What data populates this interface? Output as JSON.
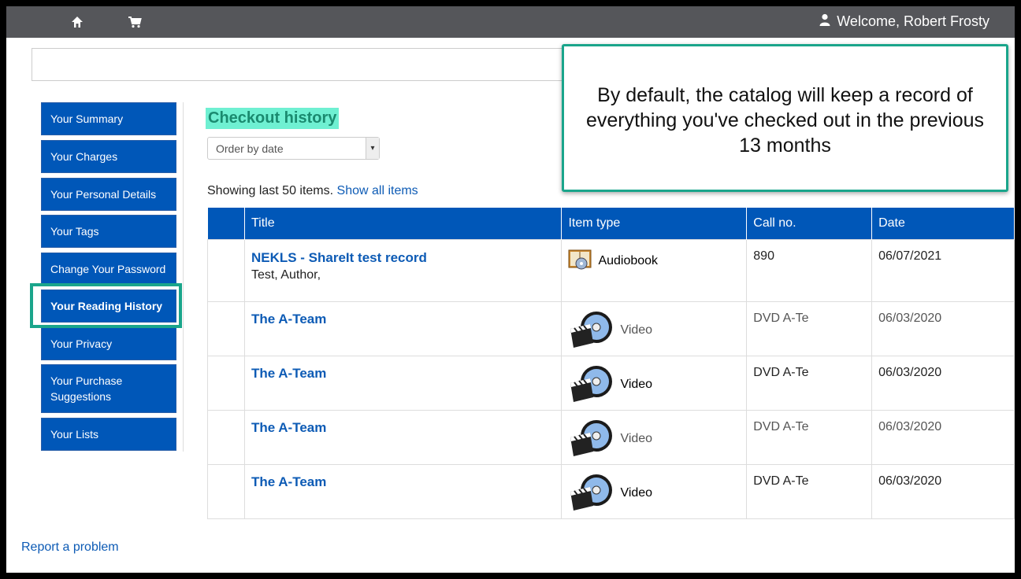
{
  "header": {
    "home_icon": "home-icon",
    "cart_icon": "cart-icon",
    "user_icon": "user-icon",
    "welcome": "Welcome, Robert Frosty"
  },
  "sidebar": {
    "items": [
      {
        "label": "Your Summary"
      },
      {
        "label": "Your Charges"
      },
      {
        "label": "Your Personal Details"
      },
      {
        "label": "Your Tags"
      },
      {
        "label": "Change Your Password"
      },
      {
        "label": "Your Reading History",
        "active": true
      },
      {
        "label": "Your Privacy"
      },
      {
        "label": "Your Purchase Suggestions"
      },
      {
        "label": "Your Lists"
      }
    ]
  },
  "main": {
    "title": "Checkout history",
    "order_select": "Order by date",
    "showing_text": "Showing last 50 items.",
    "show_all_link": "Show all items",
    "table": {
      "headers": [
        "",
        "Title",
        "Item type",
        "Call no.",
        "Date"
      ],
      "rows": [
        {
          "title": "NEKLS - ShareIt test record",
          "author": "Test, Author,",
          "type": "Audiobook",
          "type_icon": "audiobook-icon",
          "call_no": "890",
          "date": "06/07/2021"
        },
        {
          "title": "The A-Team",
          "author": "",
          "type": "Video",
          "type_icon": "video-icon",
          "call_no": "DVD A-Te",
          "date": "06/03/2020"
        },
        {
          "title": "The A-Team",
          "author": "",
          "type": "Video",
          "type_icon": "video-icon",
          "call_no": "DVD A-Te",
          "date": "06/03/2020"
        },
        {
          "title": "The A-Team",
          "author": "",
          "type": "Video",
          "type_icon": "video-icon",
          "call_no": "DVD A-Te",
          "date": "06/03/2020"
        },
        {
          "title": "The A-Team",
          "author": "",
          "type": "Video",
          "type_icon": "video-icon",
          "call_no": "DVD A-Te",
          "date": "06/03/2020"
        }
      ]
    }
  },
  "callout": {
    "text": "By default, the catalog will keep a record of everything you've checked out in the previous 13 months"
  },
  "footer": {
    "report_link": "Report a problem"
  },
  "colors": {
    "nav_blue": "#0057b8",
    "accent_teal": "#1aa58b",
    "title_highlight": "#6ff0d2",
    "link_blue": "#0d5bb5"
  }
}
